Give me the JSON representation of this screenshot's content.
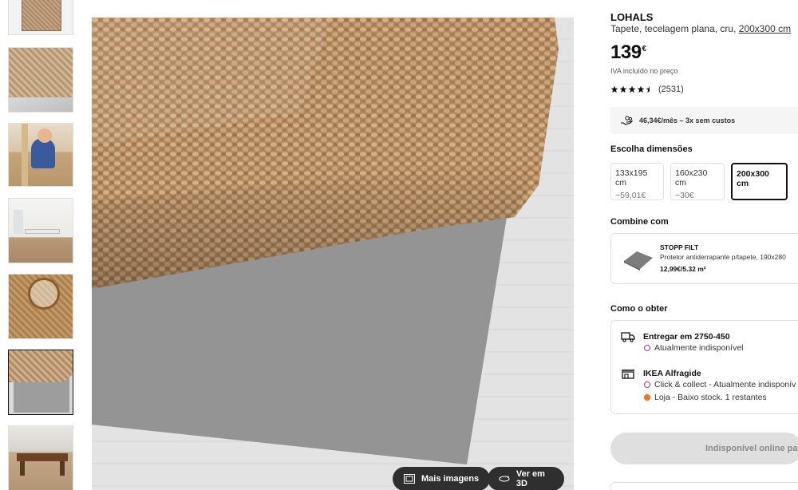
{
  "thumbnails": [
    {
      "name": "thumb-rug-top",
      "active": false
    },
    {
      "name": "thumb-rug-fold",
      "active": false
    },
    {
      "name": "thumb-child-on-rug",
      "active": false
    },
    {
      "name": "thumb-dining-room",
      "active": false
    },
    {
      "name": "thumb-basket-on-rug",
      "active": false
    },
    {
      "name": "thumb-rug-with-underlay",
      "active": true
    },
    {
      "name": "thumb-living-room",
      "active": false
    }
  ],
  "main_image": {
    "more_images_label": "Mais imagens",
    "view_3d_label": "Ver em 3D"
  },
  "product": {
    "brand": "LOHALS",
    "description": "Tapete, tecelagem plana, cru,",
    "size": "200x300 cm",
    "price": "139",
    "currency": "€",
    "vat_note": "IVA incluído no preço",
    "rating_value": 4.5,
    "review_count": "(2531)",
    "finance_text": "46,34€/mês – 3x sem custos"
  },
  "dimensions": {
    "title": "Escolha dimensões",
    "options": [
      {
        "size": "133x195 cm",
        "diff": "−59,01€",
        "selected": false
      },
      {
        "size": "160x230 cm",
        "diff": "−30€",
        "selected": false
      },
      {
        "size": "200x300 cm",
        "diff": "",
        "selected": true
      }
    ]
  },
  "combine": {
    "title": "Combine com",
    "item_name": "STOPP FILT",
    "item_desc": "Protetor antiderrapante p/tapete, 190x280",
    "item_price": "12,99€/5.32 m²"
  },
  "get_it": {
    "title": "Como o obter",
    "delivery_title": "Entregar em 2750-450",
    "delivery_status": "Atualmente indisponível",
    "store_title": "IKEA Alfragide",
    "click_collect": "Click & collect - Atualmente indisponív",
    "store_stock": "Loja - Baixo stock. 1 restantes"
  },
  "buy_button": "Indisponível online par",
  "colors": {
    "status_unavailable": "#b8317d",
    "status_low_stock": "#e9772a",
    "button_disabled": "#dfdfdf"
  }
}
